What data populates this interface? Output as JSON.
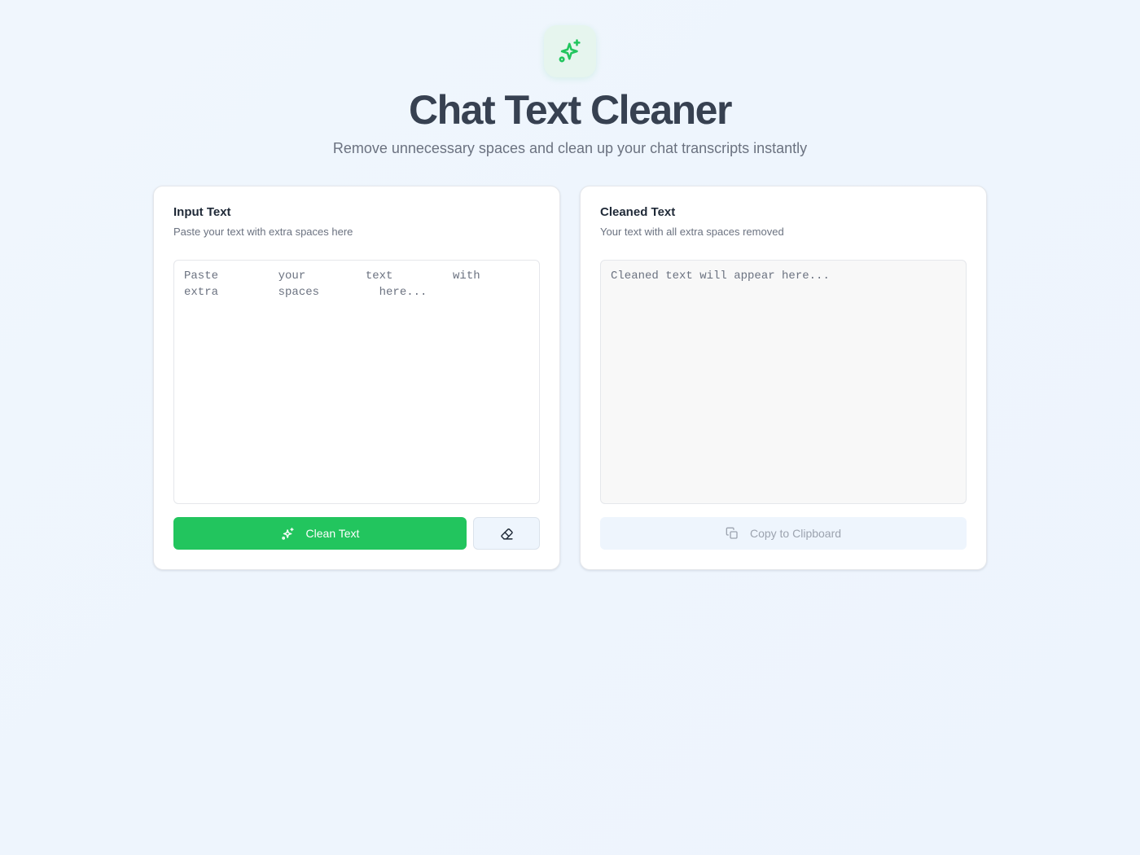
{
  "header": {
    "logo_icon": "sparkles-icon",
    "title": "Chat Text Cleaner",
    "subtitle": "Remove unnecessary spaces and clean up your chat transcripts instantly"
  },
  "input_panel": {
    "title": "Input Text",
    "description": "Paste your text with extra spaces here",
    "textarea_value": "",
    "textarea_placeholder": "Paste    your    text    with    extra    spaces    here...",
    "clean_button_label": "Clean Text",
    "clean_button_icon": "sparkles-icon",
    "clear_button_icon": "eraser-icon"
  },
  "output_panel": {
    "title": "Cleaned Text",
    "description": "Your text with all extra spaces removed",
    "textarea_value": "",
    "textarea_placeholder": "Cleaned text will appear here...",
    "copy_button_label": "Copy to Clipboard",
    "copy_button_icon": "copy-icon"
  },
  "colors": {
    "accent": "#22c55e",
    "title": "#374151",
    "muted": "#6b7280",
    "background": "#eef5fd"
  }
}
